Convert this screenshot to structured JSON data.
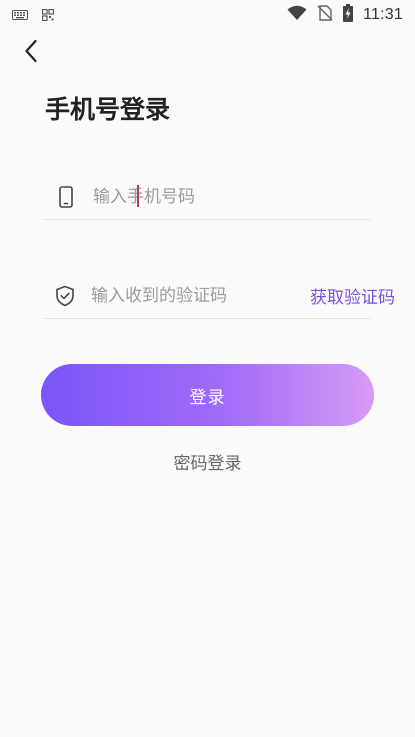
{
  "status_bar": {
    "time": "11:31",
    "left_icons": [
      "keyboard-icon",
      "qr-grid-icon"
    ],
    "right_icons": [
      "wifi-icon",
      "no-sim-icon",
      "battery-charging-icon"
    ]
  },
  "header": {
    "back_icon": "chevron-left-icon",
    "title": "手机号登录"
  },
  "form": {
    "phone": {
      "icon": "phone-icon",
      "placeholder": "输入手机号码",
      "value": ""
    },
    "code": {
      "icon": "shield-check-icon",
      "placeholder": "输入收到的验证码",
      "value": "",
      "get_code_label": "获取验证码"
    },
    "login_label": "登录",
    "password_login_label": "密码登录"
  },
  "colors": {
    "accent": "#7a4fe0",
    "button_gradient_start": "#7b55fb",
    "button_gradient_end": "#d79af6",
    "cursor": "#b23a6a"
  }
}
